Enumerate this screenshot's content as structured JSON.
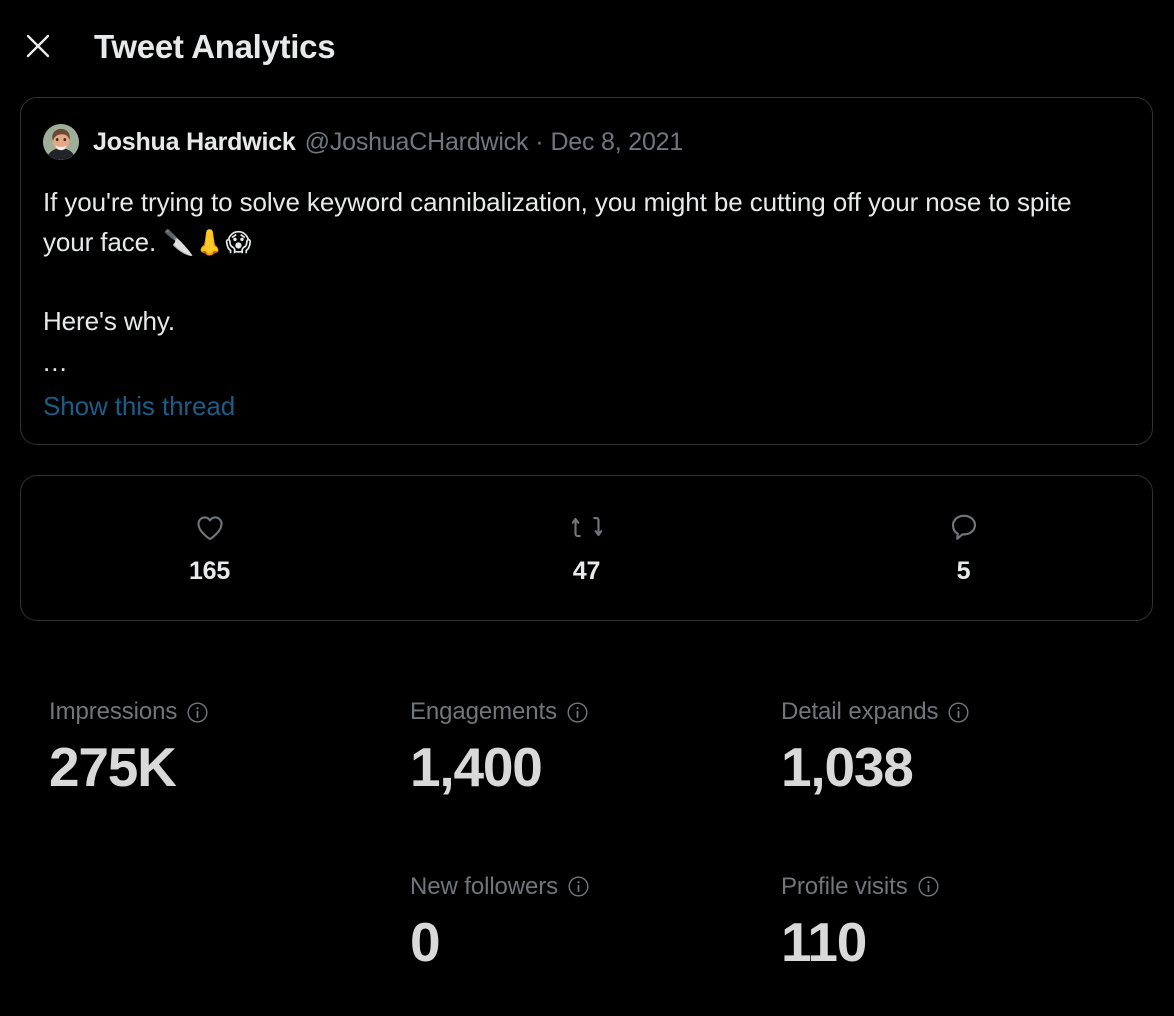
{
  "header": {
    "title": "Tweet Analytics",
    "close_label": "Close",
    "close_icon": "close-icon"
  },
  "tweet": {
    "author": {
      "display_name": "Joshua Hardwick",
      "handle": "@JoshuaCHardwick",
      "avatar_alt": "Joshua Hardwick profile photo"
    },
    "separator": "·",
    "date": "Dec 8, 2021",
    "body_line1": "If you're trying to solve keyword cannibalization, you might be cutting off your nose to spite your face. ",
    "emojis": "🔪👃😱",
    "body_line2": "Here's why.",
    "ellipsis": "...",
    "show_thread_label": "Show this thread"
  },
  "engagement_stats": [
    {
      "icon": "heart-icon",
      "name": "likes",
      "value": "165"
    },
    {
      "icon": "retweet-icon",
      "name": "retweets",
      "value": "47"
    },
    {
      "icon": "reply-icon",
      "name": "replies",
      "value": "5"
    }
  ],
  "metrics": {
    "row1": [
      {
        "label": "Impressions",
        "value": "275K",
        "info_icon": "info-icon"
      },
      {
        "label": "Engagements",
        "value": "1,400",
        "info_icon": "info-icon"
      },
      {
        "label": "Detail expands",
        "value": "1,038",
        "info_icon": "info-icon"
      }
    ],
    "row2": [
      {
        "label": "New followers",
        "value": "0",
        "info_icon": "info-icon"
      },
      {
        "label": "Profile visits",
        "value": "110",
        "info_icon": "info-icon"
      }
    ]
  },
  "colors": {
    "background": "#000000",
    "text_primary": "#e7e9ea",
    "text_secondary": "#71767b",
    "border": "#2f3336",
    "link_blue": "#1c5d88",
    "metric_value": "#d9d9d9"
  }
}
